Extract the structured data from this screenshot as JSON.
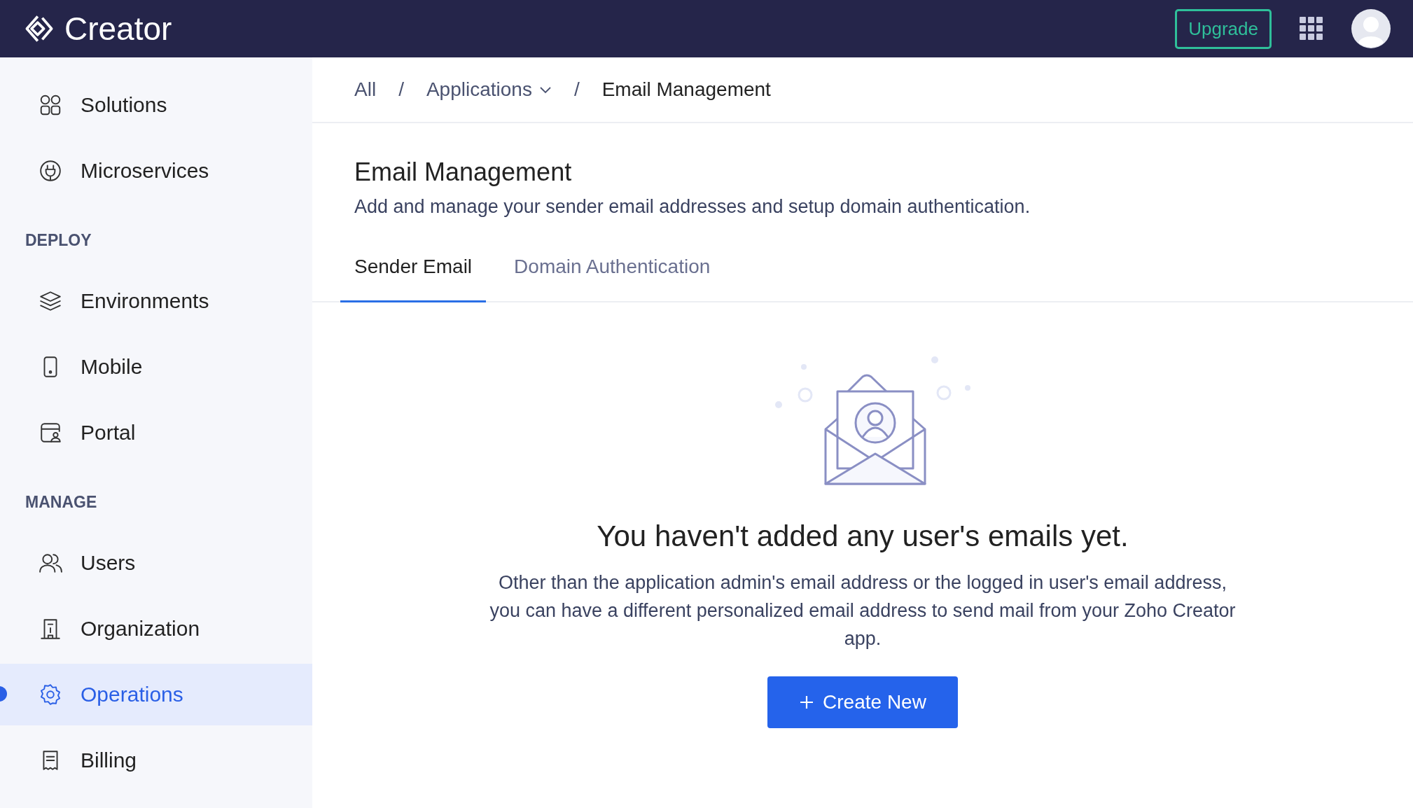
{
  "app": {
    "name": "Creator",
    "upgrade": "Upgrade"
  },
  "sidebar": {
    "sections": [
      {
        "items": [
          {
            "label": "Solutions",
            "selected": false
          },
          {
            "label": "Microservices",
            "selected": false
          }
        ]
      },
      {
        "heading": "DEPLOY",
        "items": [
          {
            "label": "Environments",
            "selected": false
          },
          {
            "label": "Mobile",
            "selected": false
          },
          {
            "label": "Portal",
            "selected": false
          }
        ]
      },
      {
        "heading": "MANAGE",
        "items": [
          {
            "label": "Users",
            "selected": false
          },
          {
            "label": "Organization",
            "selected": false
          },
          {
            "label": "Operations",
            "selected": true
          },
          {
            "label": "Billing",
            "selected": false
          }
        ]
      }
    ]
  },
  "breadcrumb": [
    {
      "label": "All",
      "dropdown": false
    },
    {
      "label": "Applications",
      "dropdown": true
    },
    {
      "label": "Email Management",
      "dropdown": false
    }
  ],
  "breadcrumb_separator": "/",
  "page": {
    "title": "Email Management",
    "subtitle": "Add and manage your sender email addresses and setup domain authentication."
  },
  "tabs": [
    {
      "label": "Sender Email",
      "selected": true
    },
    {
      "label": "Domain Authentication",
      "selected": false
    }
  ],
  "empty_state": {
    "heading": "You haven't added any user's emails yet.",
    "text": "Other than the application admin's email address or the logged in user's email address, you can have a different personalized email address to send mail from your Zoho Creator app.",
    "button": "Create New"
  }
}
